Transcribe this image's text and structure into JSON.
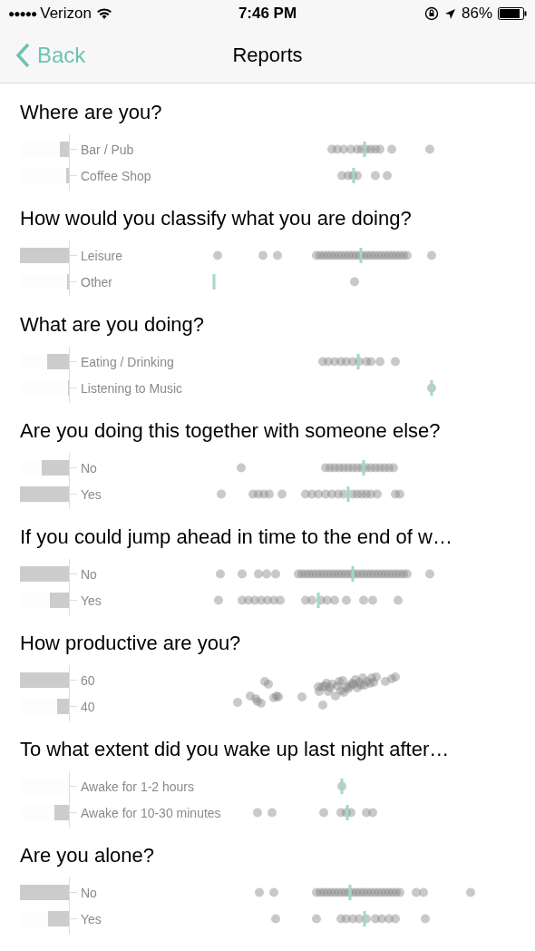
{
  "status_bar": {
    "signal_dots": "●●●●●",
    "carrier": "Verizon",
    "time": "7:46 PM",
    "battery": "86%"
  },
  "nav": {
    "back": "Back",
    "title": "Reports"
  },
  "sections": [
    {
      "title": "Where are you?",
      "rows": [
        {
          "label": "Bar / Pub",
          "level": 0.18
        },
        {
          "label": "Coffee Shop",
          "level": 0.06
        }
      ]
    },
    {
      "title": "How would you classify what you are doing?",
      "rows": [
        {
          "label": "Leisure",
          "level": 1
        },
        {
          "label": "Other",
          "level": 0.03
        }
      ]
    },
    {
      "title": "What are you doing?",
      "rows": [
        {
          "label": "Eating / Drinking",
          "level": 0.45
        },
        {
          "label": "Listening to Music",
          "level": 0.02
        }
      ]
    },
    {
      "title": "Are you doing this together with someone else?",
      "rows": [
        {
          "label": "No",
          "level": 0.55
        },
        {
          "label": "Yes",
          "level": 1
        }
      ]
    },
    {
      "title": "If you could jump ahead in time to the end of w…",
      "rows": [
        {
          "label": "No",
          "level": 1
        },
        {
          "label": "Yes",
          "level": 0.38
        }
      ]
    },
    {
      "title": "How productive are you?",
      "rows": [
        {
          "label": "60",
          "level": 1
        },
        {
          "label": "40",
          "level": 0.24
        }
      ]
    },
    {
      "title": "To what extent did you wake up last night after…",
      "rows": [
        {
          "label": "Awake for 1-2 hours",
          "level": 0
        },
        {
          "label": "Awake for 10-30 minutes",
          "level": 0.3
        }
      ]
    },
    {
      "title": "Are you alone?",
      "rows": [
        {
          "label": "No",
          "level": 1
        },
        {
          "label": "Yes",
          "level": 0.42
        }
      ]
    }
  ]
}
